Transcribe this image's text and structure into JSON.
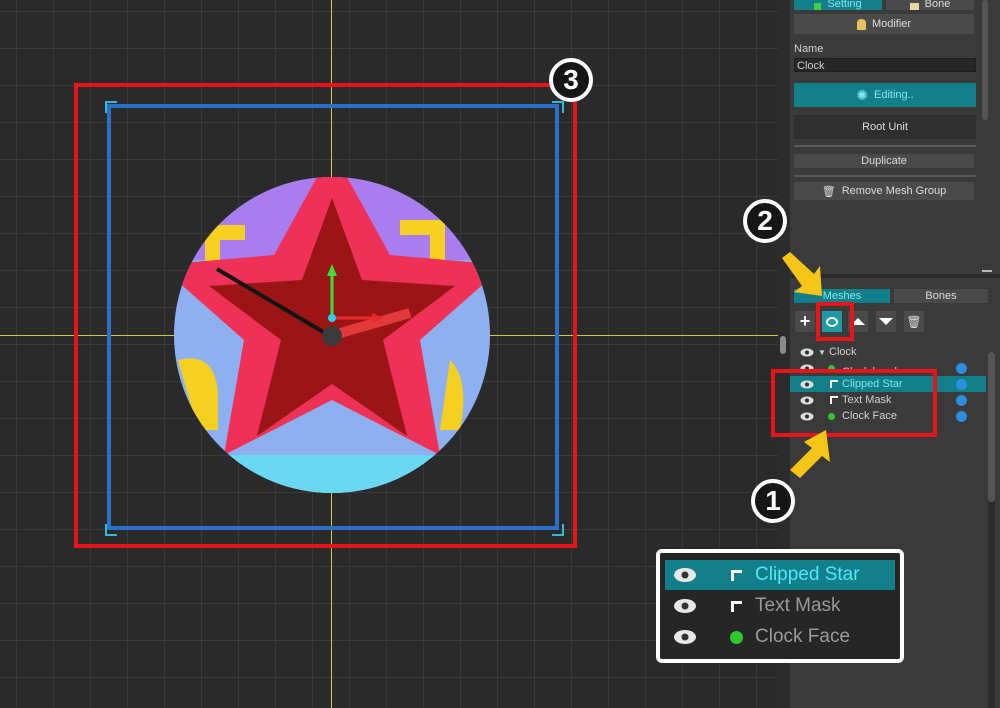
{
  "annotations": {
    "badge_1": "1",
    "badge_2": "2",
    "badge_3": "3"
  },
  "panel": {
    "tab_setting": "Setting",
    "tab_bone": "Bone",
    "modifier_button": "Modifier",
    "name_label": "Name",
    "name_value": "Clock",
    "editing_button": "Editing..",
    "root_unit_button": "Root Unit",
    "duplicate_button": "Duplicate",
    "remove_button": "Remove Mesh Group",
    "subtab_meshes": "Meshes",
    "subtab_bones": "Bones"
  },
  "tree": {
    "root": "Clock",
    "items": [
      {
        "label": "Clock hands",
        "icon": "green-mesh-icon"
      },
      {
        "label": "Clipped Star",
        "icon": "clip-icon",
        "selected": true
      },
      {
        "label": "Text Mask",
        "icon": "clip-icon"
      },
      {
        "label": "Clock Face",
        "icon": "green-mesh-icon"
      }
    ]
  },
  "zoom_panel": {
    "rows": [
      {
        "label": "Clipped Star",
        "selected": true
      },
      {
        "label": "Text Mask"
      },
      {
        "label": "Clock Face"
      }
    ]
  },
  "colors": {
    "accent": "#137f8a",
    "selected_text": "#7fe8f0",
    "annotation_red": "#e8141c",
    "annotation_blue": "#2a6fc8",
    "arrow_yellow": "#f5c518",
    "star_outer": "#ef3157",
    "star_inner": "#9b1516"
  }
}
